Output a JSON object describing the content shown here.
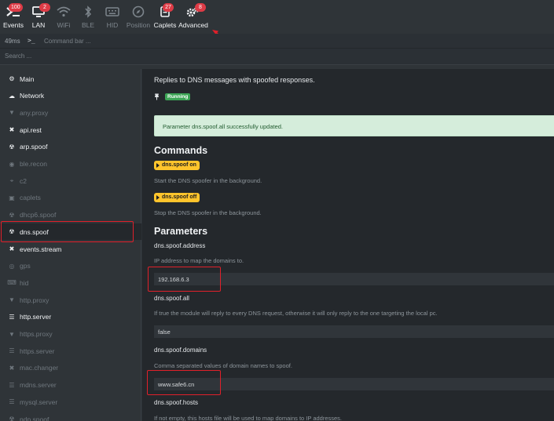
{
  "topbar": {
    "items": [
      {
        "label": "Events",
        "icon": "terminal-icon",
        "badge": "100"
      },
      {
        "label": "LAN",
        "icon": "monitor-icon",
        "badge": "2"
      },
      {
        "label": "WiFi",
        "icon": "wifi-icon",
        "badge": ""
      },
      {
        "label": "BLE",
        "icon": "bluetooth-icon",
        "badge": ""
      },
      {
        "label": "HID",
        "icon": "keyboard-icon",
        "badge": ""
      },
      {
        "label": "Position",
        "icon": "compass-icon",
        "badge": ""
      },
      {
        "label": "Caplets",
        "icon": "scroll-icon",
        "badge": "27"
      },
      {
        "label": "Advanced",
        "icon": "gears-icon",
        "badge": "8"
      }
    ]
  },
  "command_bar": {
    "latency": "49ms",
    "prompt": ">_",
    "placeholder": "Command bar ..."
  },
  "search": {
    "placeholder": "Search ..."
  },
  "sidebar": {
    "items": [
      {
        "label": "Main",
        "active": true
      },
      {
        "label": "Network",
        "active": true
      },
      {
        "label": "any.proxy",
        "active": false
      },
      {
        "label": "api.rest",
        "active": true
      },
      {
        "label": "arp.spoof",
        "active": true
      },
      {
        "label": "ble.recon",
        "active": false
      },
      {
        "label": "c2",
        "active": false
      },
      {
        "label": "caplets",
        "active": false
      },
      {
        "label": "dhcp6.spoof",
        "active": false
      },
      {
        "label": "dns.spoof",
        "active": true
      },
      {
        "label": "events.stream",
        "active": true
      },
      {
        "label": "gps",
        "active": false
      },
      {
        "label": "hid",
        "active": false
      },
      {
        "label": "http.proxy",
        "active": false
      },
      {
        "label": "http.server",
        "active": true
      },
      {
        "label": "https.proxy",
        "active": false
      },
      {
        "label": "https.server",
        "active": false
      },
      {
        "label": "mac.changer",
        "active": false
      },
      {
        "label": "mdns.server",
        "active": false
      },
      {
        "label": "mysql.server",
        "active": false
      },
      {
        "label": "ndp.spoof",
        "active": false
      }
    ]
  },
  "module": {
    "description": "Replies to DNS messages with spoofed responses.",
    "status": "Running",
    "alert": "Parameter dns.spoof.all successfully updated.",
    "commands_title": "Commands",
    "commands": [
      {
        "name": "dns.spoof on",
        "desc": "Start the DNS spoofer in the background."
      },
      {
        "name": "dns.spoof off",
        "desc": "Stop the DNS spoofer in the background."
      }
    ],
    "parameters_title": "Parameters",
    "parameters": [
      {
        "name": "dns.spoof.address",
        "desc": "IP address to map the domains to.",
        "value": "192.168.6.3"
      },
      {
        "name": "dns.spoof.all",
        "desc": "If true the module will reply to every DNS request, otherwise it will only reply to the one targeting the local pc.",
        "value": "false"
      },
      {
        "name": "dns.spoof.domains",
        "desc": "Comma separated values of domain names to spoof.",
        "value": "www.safe6.cn"
      },
      {
        "name": "dns.spoof.hosts",
        "desc": "If not empty, this hosts file will be used to map domains to IP addresses.",
        "value": ""
      }
    ]
  },
  "colors": {
    "accent_red": "#e0202a",
    "badge": "#dd3b46",
    "running": "#3ca455",
    "command_pill": "#ffc42c",
    "alert_bg": "#d5eddb"
  }
}
